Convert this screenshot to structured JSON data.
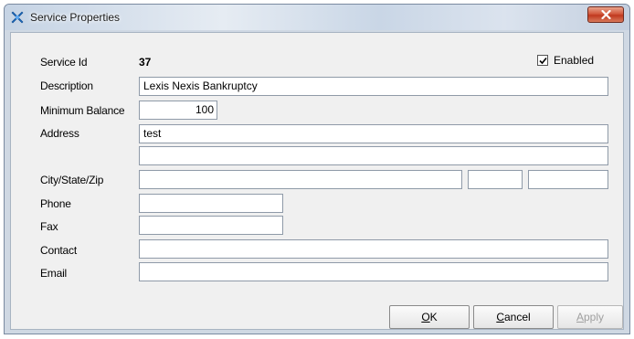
{
  "window": {
    "title": "Service Properties",
    "app_icon": "service-app-icon",
    "close_icon": "close-icon"
  },
  "form": {
    "service_id": {
      "label": "Service Id",
      "value": "37"
    },
    "enabled": {
      "label": "Enabled",
      "checked": true
    },
    "description": {
      "label": "Description",
      "value": "Lexis Nexis Bankruptcy"
    },
    "minimum_balance": {
      "label": "Minimum Balance",
      "value": "100"
    },
    "address": {
      "label": "Address",
      "line1": "test",
      "line2": ""
    },
    "city_state_zip": {
      "label": "City/State/Zip",
      "city": "",
      "state": "",
      "zip": ""
    },
    "phone": {
      "label": "Phone",
      "value": ""
    },
    "fax": {
      "label": "Fax",
      "value": ""
    },
    "contact": {
      "label": "Contact",
      "value": ""
    },
    "email": {
      "label": "Email",
      "value": ""
    }
  },
  "buttons": {
    "ok": {
      "mnemonic": "O",
      "rest": "K",
      "enabled": true
    },
    "cancel": {
      "mnemonic": "C",
      "rest": "ancel",
      "enabled": true
    },
    "apply": {
      "mnemonic": "A",
      "rest": "pply",
      "enabled": false
    }
  },
  "colors": {
    "client_bg": "#f0f0f0",
    "close_red": "#c0391f",
    "icon_blue": "#1e6fc4"
  }
}
